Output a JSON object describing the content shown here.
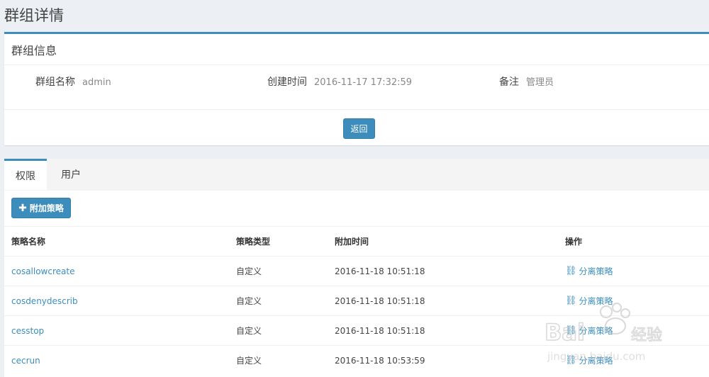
{
  "page_title": "群组详情",
  "info_box": {
    "header": "群组信息",
    "fields": [
      {
        "label": "群组名称",
        "value": "admin"
      },
      {
        "label": "创建时间",
        "value": "2016-11-17 17:32:59"
      },
      {
        "label": "备注",
        "value": "管理员"
      }
    ],
    "back_label": "返回"
  },
  "tabs": [
    {
      "label": "权限",
      "active": true
    },
    {
      "label": "用户",
      "active": false
    }
  ],
  "add_button_label": "附加策略",
  "table": {
    "headers": [
      "策略名称",
      "策略类型",
      "附加时间",
      "操作"
    ],
    "rows": [
      {
        "name": "cosallowcreate",
        "type": "自定义",
        "time": "2016-11-18 10:51:18",
        "action": "分离策略"
      },
      {
        "name": "cosdenydescrib",
        "type": "自定义",
        "time": "2016-11-18 10:51:18",
        "action": "分离策略"
      },
      {
        "name": "cesstop",
        "type": "自定义",
        "time": "2016-11-18 10:51:18",
        "action": "分离策略"
      },
      {
        "name": "cecrun",
        "type": "自定义",
        "time": "2016-11-18 10:53:59",
        "action": "分离策略"
      }
    ]
  },
  "colors": {
    "accent": "#3c8dbc",
    "background": "#ecf0f5"
  }
}
